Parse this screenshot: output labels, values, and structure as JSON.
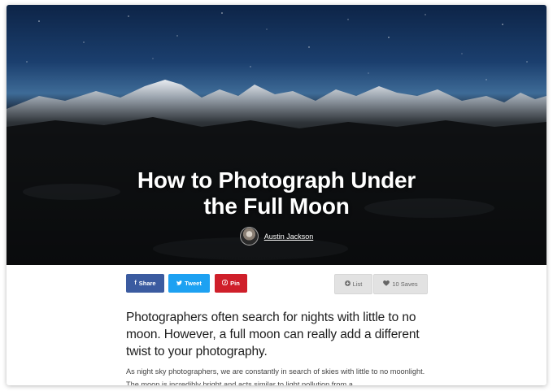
{
  "article": {
    "title_line1": "How to Photograph Under",
    "title_line2": "the Full Moon",
    "author": "Austin Jackson",
    "lead": "Photographers often search for nights with little to no moon. However, a full moon can really add a different twist to your photography.",
    "body": "As night sky photographers, we are constantly in search of skies with little to no moonlight. The moon is incredibly bright and acts similar to light pollution from a"
  },
  "share": {
    "share_label": "Share",
    "tweet_label": "Tweet",
    "pin_label": "Pin",
    "list_label": "List",
    "saves_label": "10 Saves"
  },
  "icons": {
    "share": "facebook-icon",
    "tweet": "twitter-icon",
    "pin": "pinterest-icon",
    "list": "plus-icon",
    "saves": "heart-icon"
  },
  "colors": {
    "share": "#3b5ba0",
    "tweet": "#1da1f2",
    "pin": "#cf1f2a",
    "neutral_button": "#e2e2e2"
  }
}
